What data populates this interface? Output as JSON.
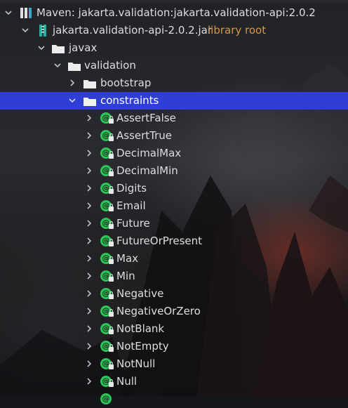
{
  "tree": {
    "maven_node": {
      "label": "Maven: jakarta.validation:jakarta.validation-api:2.0.2"
    },
    "jar_node": {
      "label": "jakarta.validation-api-2.0.2.jar",
      "tag": "library root"
    },
    "javax": {
      "label": "javax"
    },
    "validation": {
      "label": "validation"
    },
    "bootstrap": {
      "label": "bootstrap"
    },
    "constraints": {
      "label": "constraints"
    },
    "annotations": [
      "AssertFalse",
      "AssertTrue",
      "DecimalMax",
      "DecimalMin",
      "Digits",
      "Email",
      "Future",
      "FutureOrPresent",
      "Max",
      "Min",
      "Negative",
      "NegativeOrZero",
      "NotBlank",
      "NotEmpty",
      "NotNull",
      "Null"
    ],
    "annotation_glyph": "@",
    "icons": {
      "expanded": "chevron-down-icon",
      "collapsed": "chevron-right-icon",
      "folder": "folder-icon",
      "jar": "jar-archive-icon",
      "maven_library": "library-icon",
      "annotation": "annotation-icon",
      "lock": "lock-icon"
    }
  },
  "colors": {
    "selection": "#2f3fd6",
    "library_root_tag": "#d39a47",
    "annotation_badge": "#2fc45a",
    "text": "#dedede"
  }
}
